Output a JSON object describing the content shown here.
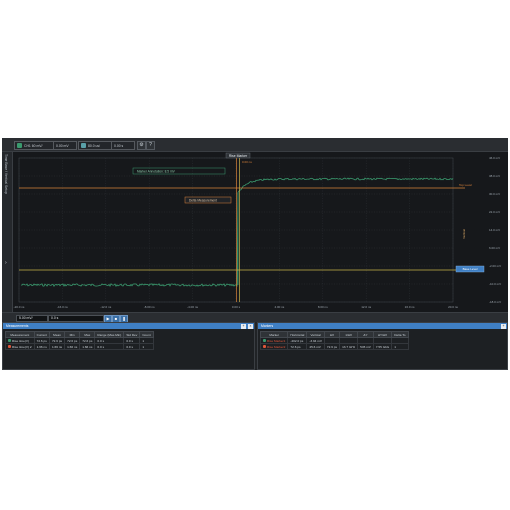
{
  "colors": {
    "background": "#1b1d20",
    "trace": "#3a9a6e",
    "marker_orange": "#d9823a",
    "marker_yellow": "#c8b44a",
    "accent_blue": "#3f7fc4",
    "marker_red": "#e0563a"
  },
  "toolbar": {
    "channel1_label": "CH1 60 mV/",
    "channel1_offset": "0.00 mV",
    "channel2_label": "80.0 us/",
    "channel2_offset": "0.00 s",
    "gear_icon": "gear-icon",
    "help_icon": "question-icon"
  },
  "left_rail": {
    "label": "Time Base / Vertical Setup",
    "expand_icon": "chevron-right-icon"
  },
  "plot": {
    "top_marker_label": "Rise Marker",
    "top_marker_sub": "0.00 ns",
    "annotation_upper": "Marker Annotation: 8.5 mV",
    "annotation_mid": "Delta Measurement",
    "level_label": "Top Level",
    "side_label": "Vertical",
    "level_lower_label": "Base Level",
    "right_ticks": [
      "46.0 mV",
      "38.0 mV",
      "30.0 mV",
      "22.0 mV",
      "14.0 mV",
      "6.00 mV",
      "-2.00 mV",
      "-10.0 mV",
      "-18.0 mV"
    ],
    "bottom_ticks": [
      "-20.0 ns",
      "-16.0 ns",
      "-12.0 ns",
      "-8.00 ns",
      "-4.00 ns",
      "0.00 s",
      "4.00 ns",
      "8.00 ns",
      "12.0 ns",
      "16.0 ns",
      "20.0 ns"
    ]
  },
  "controls": {
    "scale_value": "5.00 mV/",
    "offset_value": "0.0 s",
    "run_icon": "play-icon",
    "stop_icon": "stop-icon",
    "single_icon": "single-step-icon"
  },
  "measurements": {
    "title": "Measurements",
    "columns": [
      "Measurement",
      "Current",
      "Mean",
      "Min",
      "Max",
      "Range (Max-Min)",
      "Std Dev",
      "Count"
    ],
    "rows": [
      [
        "Rise time(V)",
        "72.6 ps",
        "72.6 ps",
        "72.6 ps",
        "72.6 ps",
        "0.0 s",
        "0.0 s",
        "1"
      ],
      [
        "Rise time(V) 2",
        "1.66 ns",
        "1.66 ns",
        "1.66 ns",
        "1.66 ns",
        "0.0 s",
        "0.0 s",
        "1"
      ]
    ]
  },
  "markers": {
    "title": "Markers",
    "columns": [
      "Marker",
      "Horizontal",
      "Vertical",
      "ΔX",
      "1/ΔX",
      "ΔY",
      "ΔY/ΔX",
      "Delta To"
    ],
    "rows": [
      [
        "Rise Marker1",
        "-402.0 ps",
        "-3.94 mV",
        "",
        "",
        "",
        "",
        ""
      ],
      [
        "Rise Marker2",
        "72.6 ps",
        "45.6 mV",
        "72.6 ps",
        "13.7 GHz",
        "545 mV",
        "7.55 Gb/s",
        "1"
      ]
    ]
  }
}
